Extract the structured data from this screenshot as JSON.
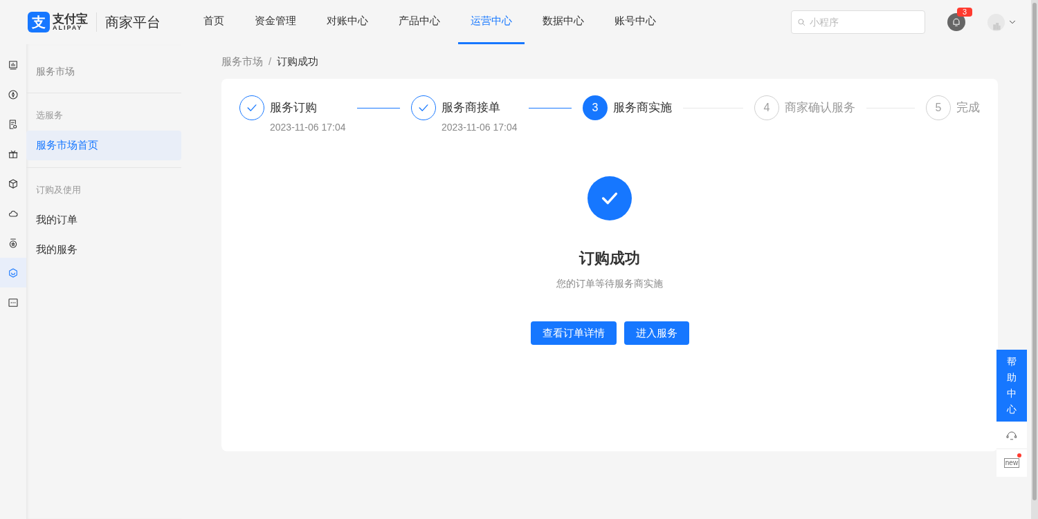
{
  "logo": {
    "mark": "支",
    "name": "支付宝",
    "sub": "ALIPAY",
    "platform": "商家平台"
  },
  "nav": [
    {
      "label": "首页",
      "selected": false
    },
    {
      "label": "资金管理",
      "selected": false
    },
    {
      "label": "对账中心",
      "selected": false
    },
    {
      "label": "产品中心",
      "selected": false
    },
    {
      "label": "运营中心",
      "selected": true
    },
    {
      "label": "数据中心",
      "selected": false
    },
    {
      "label": "账号中心",
      "selected": false
    }
  ],
  "search": {
    "placeholder": "小程序"
  },
  "notifications": {
    "count": "3"
  },
  "rail": [
    {
      "kind": "chart",
      "selected": false
    },
    {
      "kind": "compass",
      "selected": false
    },
    {
      "kind": "doc",
      "selected": false
    },
    {
      "kind": "gift",
      "selected": false
    },
    {
      "kind": "box",
      "selected": false
    },
    {
      "kind": "cloud",
      "selected": false
    },
    {
      "kind": "badge",
      "selected": false
    },
    {
      "kind": "hex",
      "selected": true
    },
    {
      "kind": "more",
      "selected": false
    }
  ],
  "sidebar": {
    "title": "服务市场",
    "groups": [
      {
        "label": "选服务",
        "items": [
          {
            "label": "服务市场首页",
            "selected": true
          }
        ]
      },
      {
        "label": "订购及使用",
        "items": [
          {
            "label": "我的订单",
            "selected": false
          },
          {
            "label": "我的服务",
            "selected": false
          }
        ]
      }
    ]
  },
  "breadcrumb": {
    "separator": "/",
    "items": [
      "服务市场",
      "订购成功"
    ]
  },
  "steps": [
    {
      "kind": "done",
      "title": "服务订购",
      "time": "2023-11-06 17:04"
    },
    {
      "kind": "done",
      "title": "服务商接单",
      "time": "2023-11-06 17:04"
    },
    {
      "kind": "active",
      "number": "3",
      "title": "服务商实施"
    },
    {
      "kind": "wait",
      "number": "4",
      "title": "商家确认服务"
    },
    {
      "kind": "wait",
      "number": "5",
      "title": "完成"
    }
  ],
  "result": {
    "title": "订购成功",
    "subtitle": "您的订单等待服务商实施",
    "buttons": [
      "查看订单详情",
      "进入服务"
    ]
  },
  "help": {
    "label": "帮助中心",
    "new_label": "new"
  }
}
